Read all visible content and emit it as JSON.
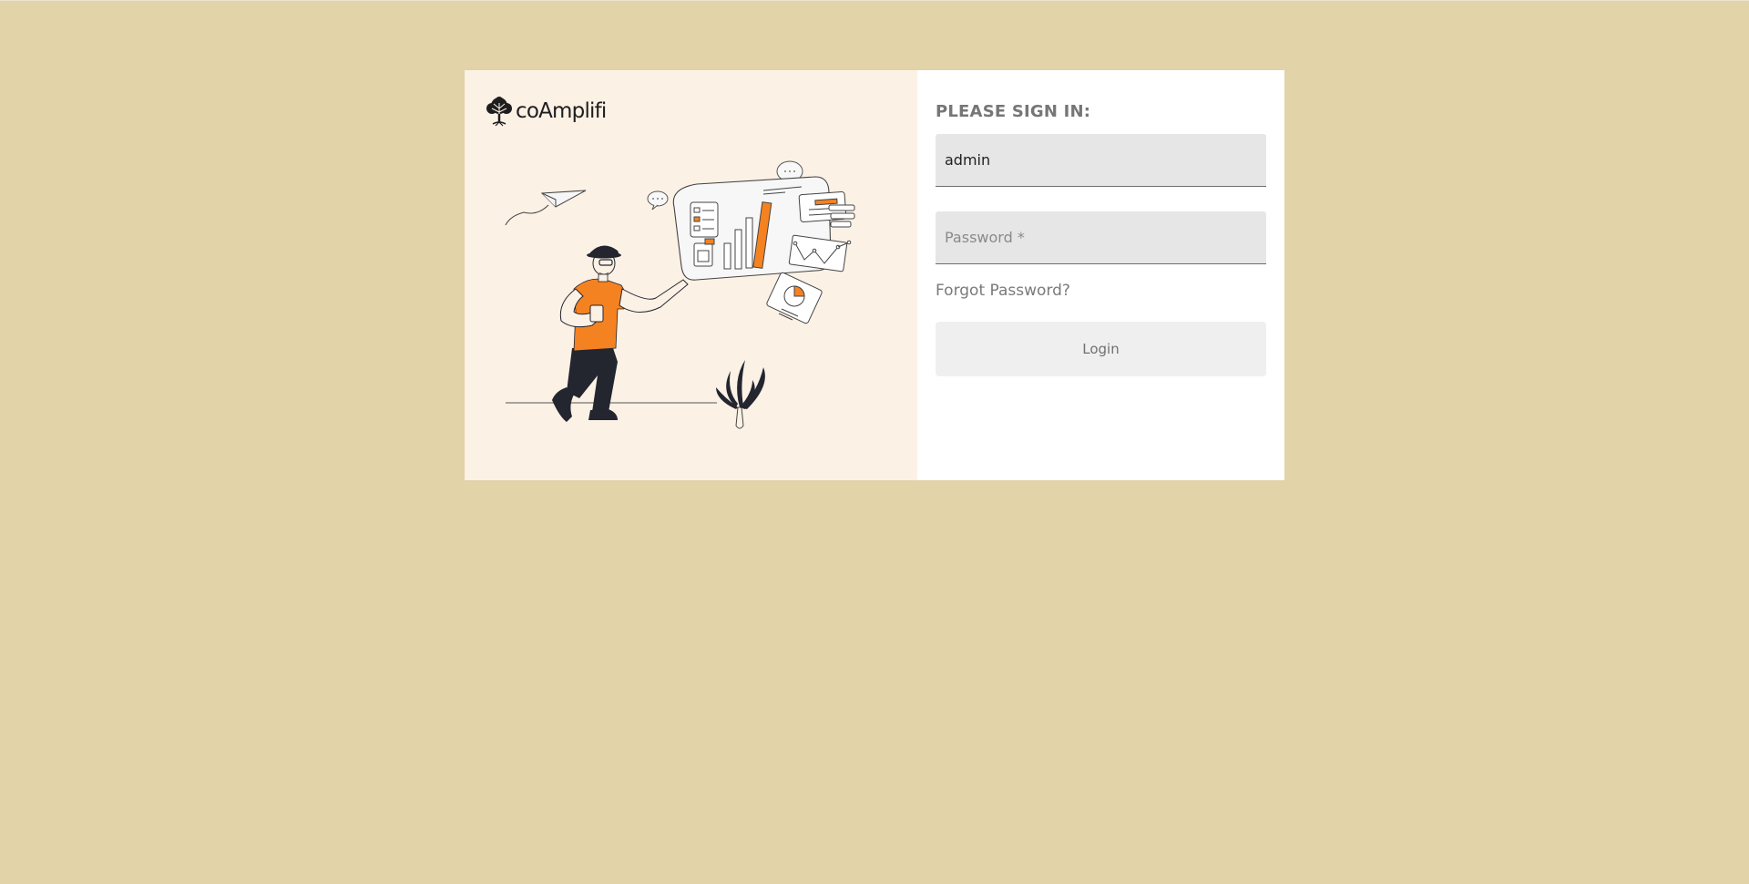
{
  "brand": {
    "name": "coAmplifi",
    "logo_icon": "tree-icon"
  },
  "illustration": {
    "icon": "presenter-dashboard-illustration",
    "accent_color": "#f58220"
  },
  "signin": {
    "title": "PLEASE SIGN IN:",
    "username_value": "admin",
    "password_placeholder": "Password *",
    "forgot_password_label": "Forgot Password?",
    "login_label": "Login"
  },
  "colors": {
    "page_background": "#e3d3a9",
    "left_panel_background": "#fbf1e5",
    "right_panel_background": "#ffffff"
  }
}
